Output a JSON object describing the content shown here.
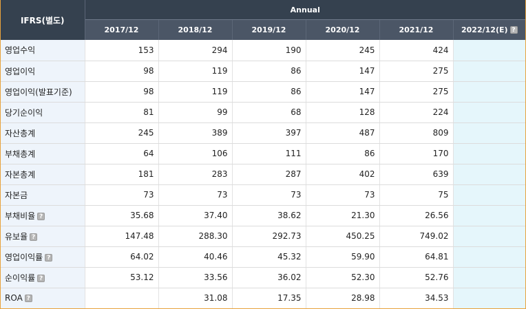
{
  "header": {
    "ifrs_label": "IFRS(별도)",
    "annual_label": "Annual",
    "years": [
      "2017/12",
      "2018/12",
      "2019/12",
      "2020/12",
      "2021/12"
    ],
    "estimate_year": "2022/12(E)",
    "info_glyph": "?"
  },
  "rows": [
    {
      "label": "영업수익",
      "info": false,
      "values": [
        "153",
        "294",
        "190",
        "245",
        "424"
      ],
      "estimate": ""
    },
    {
      "label": "영업이익",
      "info": false,
      "values": [
        "98",
        "119",
        "86",
        "147",
        "275"
      ],
      "estimate": ""
    },
    {
      "label": "영업이익(발표기준)",
      "info": false,
      "values": [
        "98",
        "119",
        "86",
        "147",
        "275"
      ],
      "estimate": ""
    },
    {
      "label": "당기순이익",
      "info": false,
      "values": [
        "81",
        "99",
        "68",
        "128",
        "224"
      ],
      "estimate": ""
    },
    {
      "label": "자산총계",
      "info": false,
      "values": [
        "245",
        "389",
        "397",
        "487",
        "809"
      ],
      "estimate": ""
    },
    {
      "label": "부채총계",
      "info": false,
      "values": [
        "64",
        "106",
        "111",
        "86",
        "170"
      ],
      "estimate": ""
    },
    {
      "label": "자본총계",
      "info": false,
      "values": [
        "181",
        "283",
        "287",
        "402",
        "639"
      ],
      "estimate": ""
    },
    {
      "label": "자본금",
      "info": false,
      "values": [
        "73",
        "73",
        "73",
        "73",
        "75"
      ],
      "estimate": ""
    },
    {
      "label": "부채비율",
      "info": true,
      "values": [
        "35.68",
        "37.40",
        "38.62",
        "21.30",
        "26.56"
      ],
      "estimate": ""
    },
    {
      "label": "유보율",
      "info": true,
      "values": [
        "147.48",
        "288.30",
        "292.73",
        "450.25",
        "749.02"
      ],
      "estimate": ""
    },
    {
      "label": "영업이익률",
      "info": true,
      "values": [
        "64.02",
        "40.46",
        "45.32",
        "59.90",
        "64.81"
      ],
      "estimate": ""
    },
    {
      "label": "순이익률",
      "info": true,
      "values": [
        "53.12",
        "33.56",
        "36.02",
        "52.30",
        "52.76"
      ],
      "estimate": ""
    },
    {
      "label": "ROA",
      "info": true,
      "values": [
        "",
        "31.08",
        "17.35",
        "28.98",
        "34.53"
      ],
      "estimate": ""
    }
  ],
  "colors": {
    "header_dark": "#35414f",
    "header_year": "#4b5666",
    "label_bg": "#eef4fb",
    "estimate_bg": "#e5f6fb",
    "frame_border": "#e8a23c"
  }
}
